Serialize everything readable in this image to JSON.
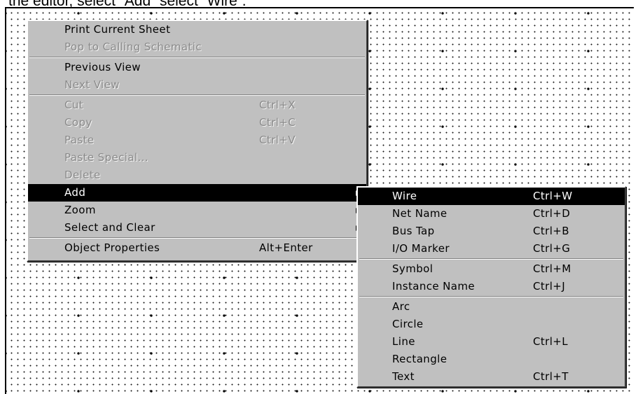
{
  "caption": "the editor, select “Add” select “Wire”.",
  "context_menu": {
    "items": [
      {
        "label": "Print Current Sheet",
        "shortcut": "",
        "state": "enabled"
      },
      {
        "label": "Pop to Calling Schematic",
        "shortcut": "",
        "state": "disabled"
      },
      {
        "label": "Previous View",
        "shortcut": "",
        "state": "enabled"
      },
      {
        "label": "Next View",
        "shortcut": "",
        "state": "disabled"
      },
      {
        "label": "Cut",
        "shortcut": "Ctrl+X",
        "state": "disabled"
      },
      {
        "label": "Copy",
        "shortcut": "Ctrl+C",
        "state": "disabled"
      },
      {
        "label": "Paste",
        "shortcut": "Ctrl+V",
        "state": "disabled"
      },
      {
        "label": "Paste Special...",
        "shortcut": "",
        "state": "disabled"
      },
      {
        "label": "Delete",
        "shortcut": "",
        "state": "disabled"
      },
      {
        "label": "Add",
        "shortcut": "",
        "state": "selected",
        "submenu_arrow": "right-triangle-icon"
      },
      {
        "label": "Zoom",
        "shortcut": "",
        "state": "enabled",
        "submenu_arrow": "right-triangle-icon"
      },
      {
        "label": "Select and Clear",
        "shortcut": "",
        "state": "enabled",
        "submenu_arrow": "right-triangle-icon"
      },
      {
        "label": "Object Properties",
        "shortcut": "Alt+Enter",
        "state": "enabled"
      }
    ]
  },
  "add_submenu": {
    "items": [
      {
        "label": "Wire",
        "shortcut": "Ctrl+W",
        "state": "selected"
      },
      {
        "label": "Net Name",
        "shortcut": "Ctrl+D",
        "state": "enabled"
      },
      {
        "label": "Bus Tap",
        "shortcut": "Ctrl+B",
        "state": "enabled"
      },
      {
        "label": "I/O Marker",
        "shortcut": "Ctrl+G",
        "state": "enabled"
      },
      {
        "label": "Symbol",
        "shortcut": "Ctrl+M",
        "state": "enabled"
      },
      {
        "label": "Instance Name",
        "shortcut": "Ctrl+J",
        "state": "enabled"
      },
      {
        "label": "Arc",
        "shortcut": "",
        "state": "enabled"
      },
      {
        "label": "Circle",
        "shortcut": "",
        "state": "enabled"
      },
      {
        "label": "Line",
        "shortcut": "Ctrl+L",
        "state": "enabled"
      },
      {
        "label": "Rectangle",
        "shortcut": "",
        "state": "enabled"
      },
      {
        "label": "Text",
        "shortcut": "Ctrl+T",
        "state": "enabled"
      }
    ]
  },
  "colors": {
    "menu_background": "#c0c0c0",
    "highlight": "#000000",
    "highlight_text": "#ffffff",
    "disabled_text": "#8a8a8a",
    "grid_dots": "#000000"
  }
}
